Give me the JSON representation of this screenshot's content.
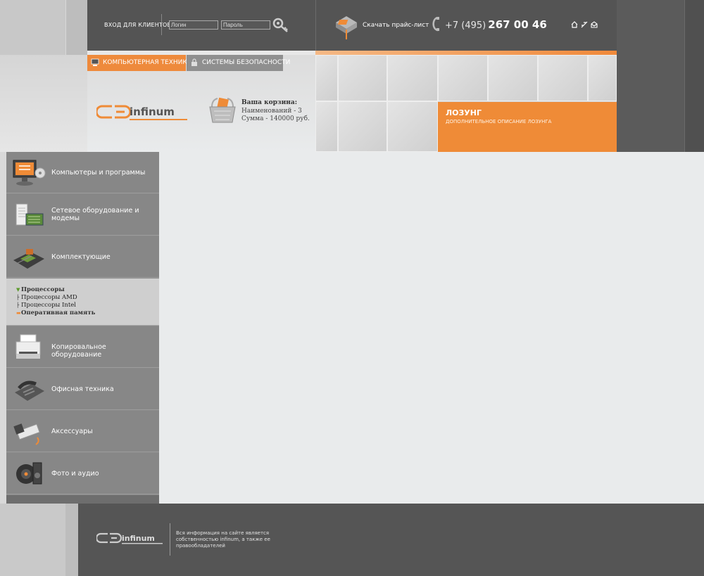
{
  "header": {
    "login_label": "ВХОД ДЛЯ КЛИЕНТОВ",
    "login_placeholder": "Логин",
    "password_placeholder": "Пароль",
    "price_link": "Скачать прайс-лист",
    "phone_prefix": "+7 (495)",
    "phone_number": "267 00 46"
  },
  "tabs": [
    {
      "label": "КОМПЬЮТЕРНАЯ ТЕХНИКА",
      "active": true
    },
    {
      "label": "СИСТЕМЫ БЕЗОПАСНОСТИ",
      "active": false
    }
  ],
  "basket": {
    "title": "Ваша корзина:",
    "items": "Наименований - 3",
    "sum": "Сумма - 140000 руб."
  },
  "slogan": {
    "title": "ЛОЗУНГ",
    "subtitle": "ДОПОЛНИТЕЛЬНОЕ ОПИСАНИЕ ЛОЗУНГА"
  },
  "menu": [
    {
      "label": "Компьютеры и программы",
      "icon": "monitor-icon"
    },
    {
      "label": "Сетевое оборудование и модемы",
      "icon": "network-icon"
    },
    {
      "label": "Комплектующие",
      "icon": "motherboard-icon"
    },
    {
      "label": "Копировальное оборудование",
      "icon": "printer-icon"
    },
    {
      "label": "Офисная техника",
      "icon": "phone-icon"
    },
    {
      "label": "Аксессуары",
      "icon": "accessory-icon"
    },
    {
      "label": "Фото и аудио",
      "icon": "audio-icon"
    }
  ],
  "submenu": {
    "group1": "Процессоры",
    "amd": "Процессоры AMD",
    "intel": "Процессоры Intel",
    "group2": "Оперативная память"
  },
  "footer": {
    "text": "Вся информация на сайте является собственностью infinum, а также ее правообладателей"
  },
  "colors": {
    "accent": "#ef8b37",
    "dark": "#555555",
    "menu": "#878787"
  }
}
